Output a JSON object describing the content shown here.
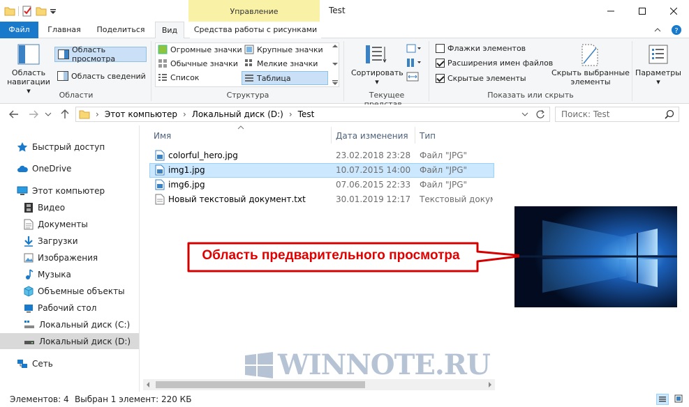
{
  "window": {
    "title": "Test",
    "context_tab": "Управление"
  },
  "tabs": {
    "file": "Файл",
    "home": "Главная",
    "share": "Поделиться",
    "view": "Вид",
    "picture_tools": "Средства работы с рисунками"
  },
  "ribbon": {
    "panes": {
      "nav_pane_line1": "Область",
      "nav_pane_line2": "навигации",
      "preview_pane": "Область просмотра",
      "details_pane": "Область сведений",
      "label": "Области"
    },
    "layout": {
      "huge_icons": "Огромные значки",
      "large_icons": "Крупные значки",
      "medium_icons": "Обычные значки",
      "small_icons": "Мелкие значки",
      "list": "Список",
      "details": "Таблица",
      "label": "Структура"
    },
    "current_view": {
      "sort_by": "Сортировать",
      "label": "Текущее представ..."
    },
    "show_hide": {
      "item_checkboxes": "Флажки элементов",
      "item_checkboxes_checked": false,
      "file_extensions": "Расширения имен файлов",
      "file_extensions_checked": true,
      "hidden_items": "Скрытые элементы",
      "hidden_items_checked": true,
      "hide_selected_line1": "Скрыть выбранные",
      "hide_selected_line2": "элементы",
      "label": "Показать или скрыть"
    },
    "options": "Параметры"
  },
  "address": {
    "crumbs": [
      "Этот компьютер",
      "Локальный диск (D:)",
      "Test"
    ],
    "search_placeholder": "Поиск: Test"
  },
  "nav": {
    "quick_access": "Быстрый доступ",
    "onedrive": "OneDrive",
    "this_pc": "Этот компьютер",
    "videos": "Видео",
    "documents": "Документы",
    "downloads": "Загрузки",
    "pictures": "Изображения",
    "music": "Музыка",
    "objects3d": "Объемные объекты",
    "desktop": "Рабочий стол",
    "disk_c": "Локальный диск (C:)",
    "disk_d": "Локальный диск (D:)",
    "network": "Сеть"
  },
  "files": {
    "headers": {
      "name": "Имя",
      "date": "Дата изменения",
      "type": "Тип"
    },
    "rows": [
      {
        "name": "colorful_hero.jpg",
        "date": "23.02.2018 23:28",
        "type": "Файл \"JPG\""
      },
      {
        "name": "img1.jpg",
        "date": "10.07.2015 14:00",
        "type": "Файл \"JPG\""
      },
      {
        "name": "img6.jpg",
        "date": "07.06.2015 22:33",
        "type": "Файл \"JPG\""
      },
      {
        "name": "Новый текстовый документ.txt",
        "date": "30.01.2019 12:17",
        "type": "Текстовый докум..."
      }
    ]
  },
  "callout": "Область предварительного просмотра",
  "watermark": "WINNOTE.RU",
  "status": {
    "count": "Элементов: 4",
    "selected": "Выбран 1 элемент: 220 КБ"
  },
  "colors": {
    "accent": "#1979ca",
    "selection": "#cce8ff",
    "context_tab": "#f9f1a6",
    "callout_text": "#e00000"
  }
}
